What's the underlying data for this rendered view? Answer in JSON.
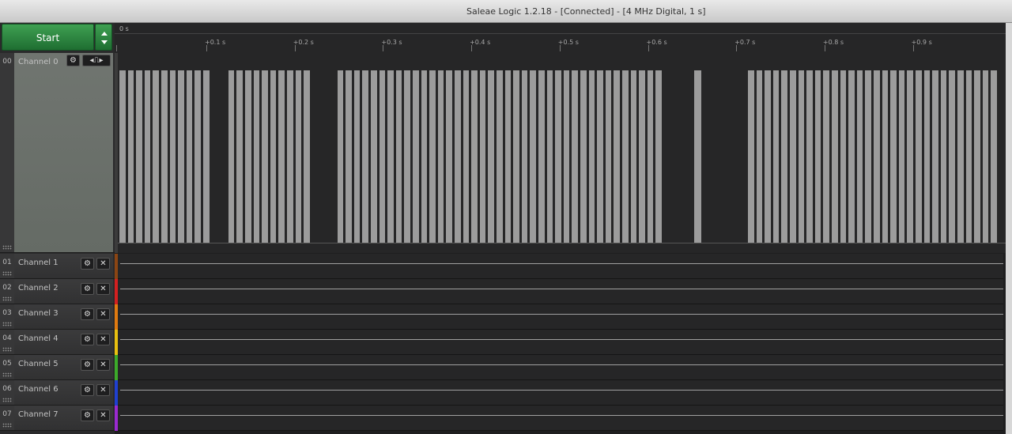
{
  "window": {
    "title": "Saleae Logic 1.2.18 - [Connected] - [4 MHz Digital, 1 s]"
  },
  "start": {
    "label": "Start"
  },
  "timeline": {
    "origin_label": "0 s",
    "ticks": [
      "+0.1 s",
      "+0.2 s",
      "+0.3 s",
      "+0.4 s",
      "+0.5 s",
      "+0.6 s",
      "+0.7 s",
      "+0.8 s",
      "+0.9 s"
    ]
  },
  "channels": [
    {
      "num": "00",
      "name": "Channel 0",
      "color": "#3c3c3c"
    },
    {
      "num": "01",
      "name": "Channel 1",
      "color": "#8b4513"
    },
    {
      "num": "02",
      "name": "Channel 2",
      "color": "#d42020"
    },
    {
      "num": "03",
      "name": "Channel 3",
      "color": "#e07a10"
    },
    {
      "num": "04",
      "name": "Channel 4",
      "color": "#e8c010"
    },
    {
      "num": "05",
      "name": "Channel 5",
      "color": "#3caa2a"
    },
    {
      "num": "06",
      "name": "Channel 6",
      "color": "#2040d0"
    },
    {
      "num": "07",
      "name": "Channel 7",
      "color": "#9a2ad0"
    }
  ],
  "icons": {
    "settings": "gear-icon",
    "close": "close-icon",
    "trigger": "pulse-trigger-icon"
  }
}
